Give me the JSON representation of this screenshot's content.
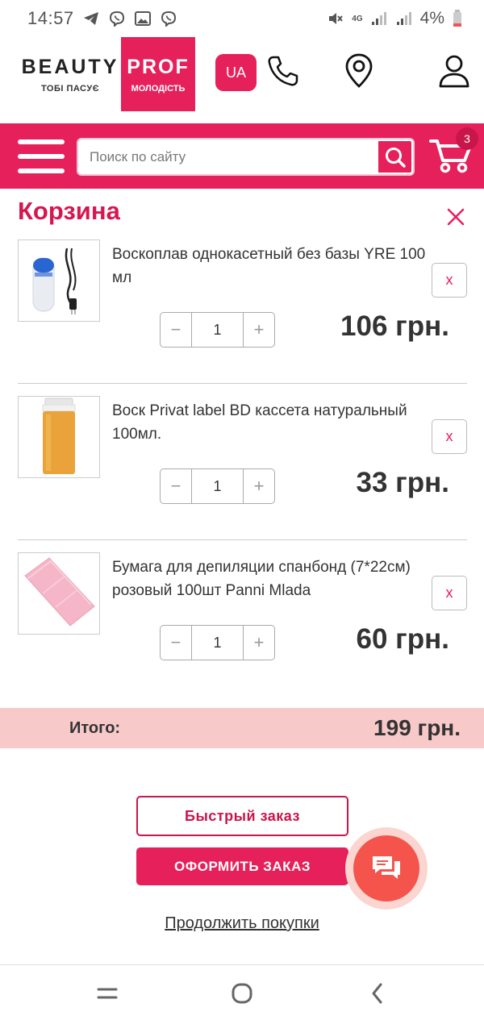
{
  "status_bar": {
    "time": "14:57",
    "network": "4G",
    "battery": "4%"
  },
  "header": {
    "logo": {
      "word1": "BEAUTY",
      "word2": "PROF",
      "tagline1": "ТОБІ ПАСУЄ",
      "tagline2": "МОЛОДІСТЬ"
    },
    "lang_label": "UA",
    "icons": [
      "phone-icon",
      "location-pin-icon",
      "user-icon"
    ]
  },
  "search": {
    "placeholder": "Поиск по сайту"
  },
  "cart": {
    "count": "3",
    "title": "Корзина",
    "remove_label": "x",
    "items": [
      {
        "name": "Воскоплав однокасетный без базы YRE 100 мл",
        "quantity": "1",
        "price": "106 грн."
      },
      {
        "name": "Воск Privat label BD кассета натуральный 100мл.",
        "quantity": "1",
        "price": "33 грн."
      },
      {
        "name": "Бумага для депиляции спанбонд (7*22см) розовый 100шт Panni Mlada",
        "quantity": "1",
        "price": "60 грн."
      }
    ],
    "qty_minus": "−",
    "qty_plus": "+",
    "total_label": "Итого:",
    "total_value": "199 грн.",
    "quick_order": "Быстрый заказ",
    "checkout": "ОФОРМИТЬ ЗАКАЗ",
    "continue": "Продолжить покупки"
  },
  "colors": {
    "brand": "#e5205a",
    "brand_dark": "#c8164b",
    "total_bg": "#f8c9c9",
    "chat": "#f4544c"
  }
}
